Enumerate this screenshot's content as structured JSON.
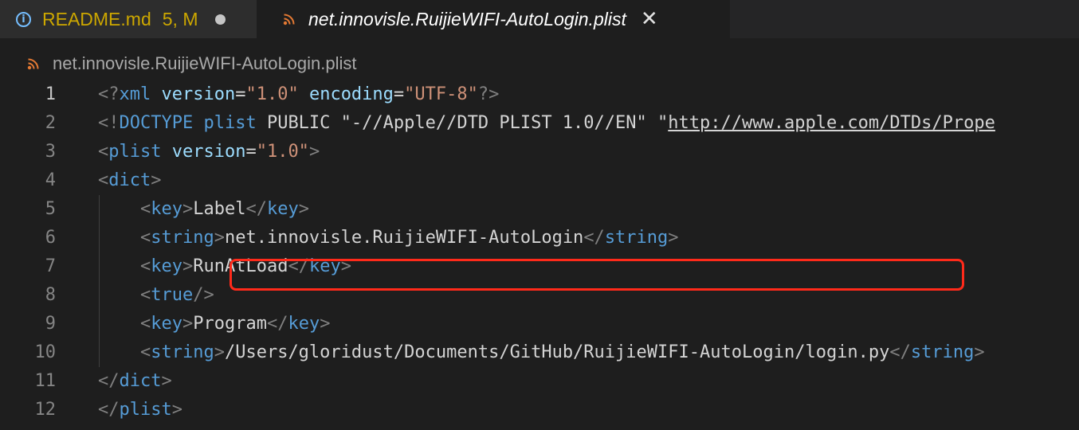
{
  "tabs": [
    {
      "label": "README.md",
      "badge": "5, M",
      "icon": "info-icon",
      "modified": true
    },
    {
      "label": "net.innovisle.RuijieWIFI-AutoLogin.plist",
      "icon": "rss-icon",
      "close": "✕",
      "active": true
    }
  ],
  "breadcrumb": {
    "file": "net.innovisle.RuijieWIFI-AutoLogin.plist"
  },
  "editor": {
    "line_numbers": [
      "1",
      "2",
      "3",
      "4",
      "5",
      "6",
      "7",
      "8",
      "9",
      "10",
      "11",
      "12"
    ],
    "lines": [
      [
        [
          "p",
          "<?"
        ],
        [
          "t",
          "xml"
        ],
        [
          "txt",
          " "
        ],
        [
          "a",
          "version"
        ],
        [
          "txt",
          "="
        ],
        [
          "s",
          "\"1.0\""
        ],
        [
          "txt",
          " "
        ],
        [
          "a",
          "encoding"
        ],
        [
          "txt",
          "="
        ],
        [
          "s",
          "\"UTF-8\""
        ],
        [
          "p",
          "?>"
        ]
      ],
      [
        [
          "p",
          "<!"
        ],
        [
          "t",
          "DOCTYPE"
        ],
        [
          "txt",
          " "
        ],
        [
          "t",
          "plist"
        ],
        [
          "txt",
          " PUBLIC \"-//Apple//DTD PLIST 1.0//EN\" \""
        ],
        [
          "u",
          "http://www.apple.com/DTDs/Prope"
        ]
      ],
      [
        [
          "p",
          "<"
        ],
        [
          "t",
          "plist"
        ],
        [
          "txt",
          " "
        ],
        [
          "a",
          "version"
        ],
        [
          "txt",
          "="
        ],
        [
          "s",
          "\"1.0\""
        ],
        [
          "p",
          ">"
        ]
      ],
      [
        [
          "p",
          "<"
        ],
        [
          "t",
          "dict"
        ],
        [
          "p",
          ">"
        ]
      ],
      [
        [
          "txt",
          "    "
        ],
        [
          "p",
          "<"
        ],
        [
          "t",
          "key"
        ],
        [
          "p",
          ">"
        ],
        [
          "txt",
          "Label"
        ],
        [
          "p",
          "</"
        ],
        [
          "t",
          "key"
        ],
        [
          "p",
          ">"
        ]
      ],
      [
        [
          "txt",
          "    "
        ],
        [
          "p",
          "<"
        ],
        [
          "t",
          "string"
        ],
        [
          "p",
          ">"
        ],
        [
          "txt",
          "net.innovisle.RuijieWIFI-AutoLogin"
        ],
        [
          "p",
          "</"
        ],
        [
          "t",
          "string"
        ],
        [
          "p",
          ">"
        ]
      ],
      [
        [
          "txt",
          "    "
        ],
        [
          "p",
          "<"
        ],
        [
          "t",
          "key"
        ],
        [
          "p",
          ">"
        ],
        [
          "txt",
          "RunAtLoad"
        ],
        [
          "p",
          "</"
        ],
        [
          "t",
          "key"
        ],
        [
          "p",
          ">"
        ]
      ],
      [
        [
          "txt",
          "    "
        ],
        [
          "p",
          "<"
        ],
        [
          "t",
          "true"
        ],
        [
          "p",
          "/>"
        ]
      ],
      [
        [
          "txt",
          "    "
        ],
        [
          "p",
          "<"
        ],
        [
          "t",
          "key"
        ],
        [
          "p",
          ">"
        ],
        [
          "txt",
          "Program"
        ],
        [
          "p",
          "</"
        ],
        [
          "t",
          "key"
        ],
        [
          "p",
          ">"
        ]
      ],
      [
        [
          "txt",
          "    "
        ],
        [
          "p",
          "<"
        ],
        [
          "t",
          "string"
        ],
        [
          "p",
          ">"
        ],
        [
          "txt",
          "/Users/gloridust/Documents/GitHub/RuijieWIFI-AutoLogin/login.py"
        ],
        [
          "p",
          "</"
        ],
        [
          "t",
          "string"
        ],
        [
          "p",
          ">"
        ]
      ],
      [
        [
          "p",
          "</"
        ],
        [
          "t",
          "dict"
        ],
        [
          "p",
          ">"
        ]
      ],
      [
        [
          "p",
          "</"
        ],
        [
          "t",
          "plist"
        ],
        [
          "p",
          ">"
        ]
      ]
    ]
  },
  "colors": {
    "highlight": "#ff2a1a",
    "accent_warning": "#cca700"
  }
}
